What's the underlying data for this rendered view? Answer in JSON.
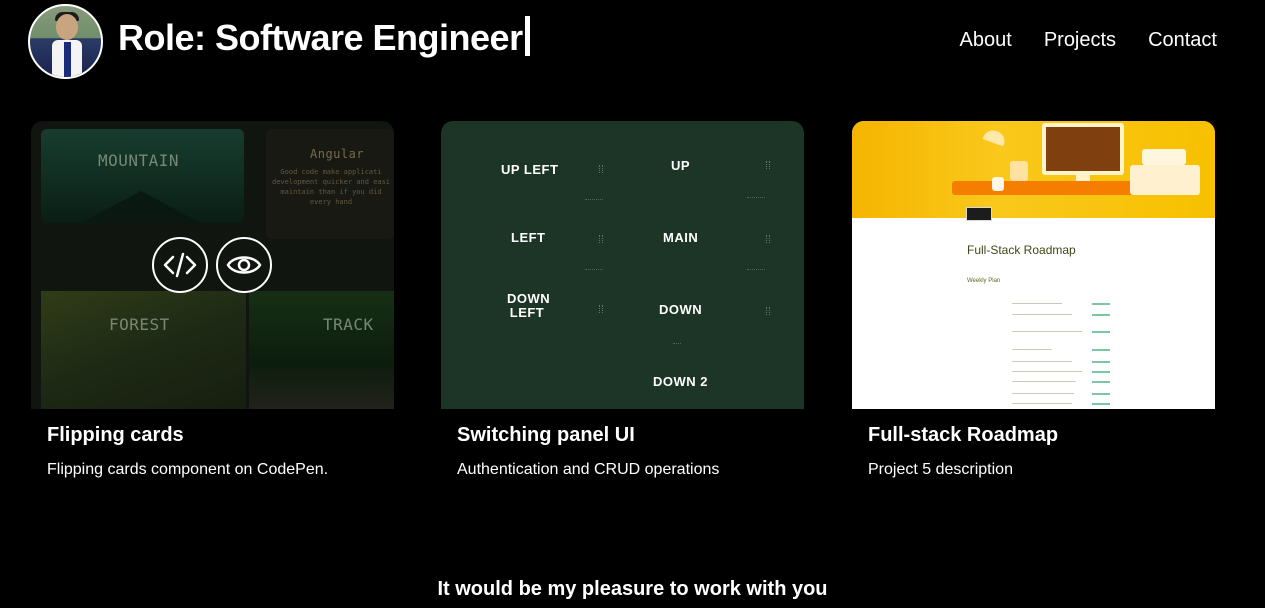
{
  "header": {
    "role_text": "Role: Software Engineer",
    "nav": [
      "About",
      "Projects",
      "Contact"
    ]
  },
  "projects": [
    {
      "title": "Flipping cards",
      "description": "Flipping cards component on CodePen.",
      "preview": {
        "panels": [
          "MOUNTAIN",
          "Angular",
          "FOREST",
          "TRACK"
        ],
        "angular_text": "Good code make applicati development quicker and easi maintain than if you did every hand"
      },
      "actions": [
        "code-icon",
        "eye-icon"
      ]
    },
    {
      "title": "Switching panel UI",
      "description": "Authentication and CRUD operations",
      "preview": {
        "labels": [
          "UP LEFT",
          "UP",
          "LEFT",
          "MAIN",
          "DOWN LEFT",
          "DOWN",
          "DOWN 2"
        ]
      }
    },
    {
      "title": "Full-stack Roadmap",
      "description": "Project 5 description",
      "preview": {
        "doc_title": "Full-Stack Roadmap",
        "doc_subtitle": "Weekly Plan"
      }
    }
  ],
  "footer": {
    "message": "It would be my pleasure to work with you"
  },
  "colors": {
    "background": "#000000",
    "text": "#ffffff",
    "panel_green": "#1d3526",
    "roadmap_yellow": "#f7c000"
  }
}
